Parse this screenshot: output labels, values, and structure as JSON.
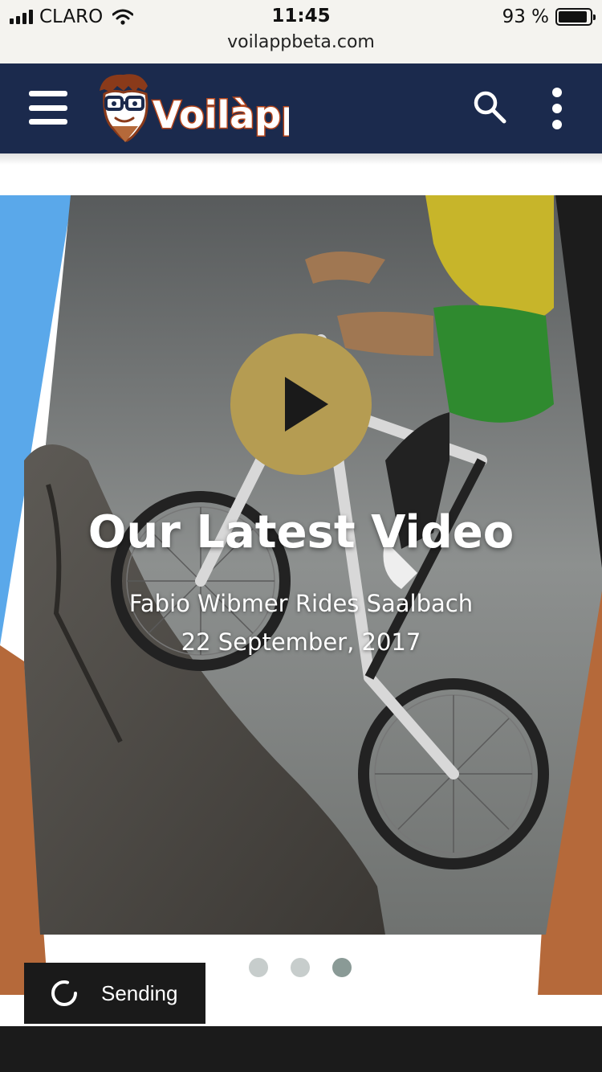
{
  "status_bar": {
    "carrier": "CLARO",
    "time": "11:45",
    "battery_percent": "93 %",
    "battery_level": 0.93,
    "url": "voilappbeta.com"
  },
  "header": {
    "logo_text": "Voilàpp",
    "menu_icon": "hamburger-icon",
    "search_icon": "search-icon",
    "more_icon": "more-vertical-icon",
    "background_color": "#1b2a4d"
  },
  "hero": {
    "title": "Our Latest Video",
    "subtitle": "Fabio Wibmer Rides Saalbach",
    "date": "22 September, 2017",
    "play_icon": "play-icon",
    "accent_color": "#b59c52",
    "left_band_color": "#5aa8ea",
    "right_band_color": "#b5693a"
  },
  "carousel": {
    "slide_count": 3,
    "active_index": 2
  },
  "toast": {
    "text": "Sending",
    "icon": "spinner-icon"
  }
}
